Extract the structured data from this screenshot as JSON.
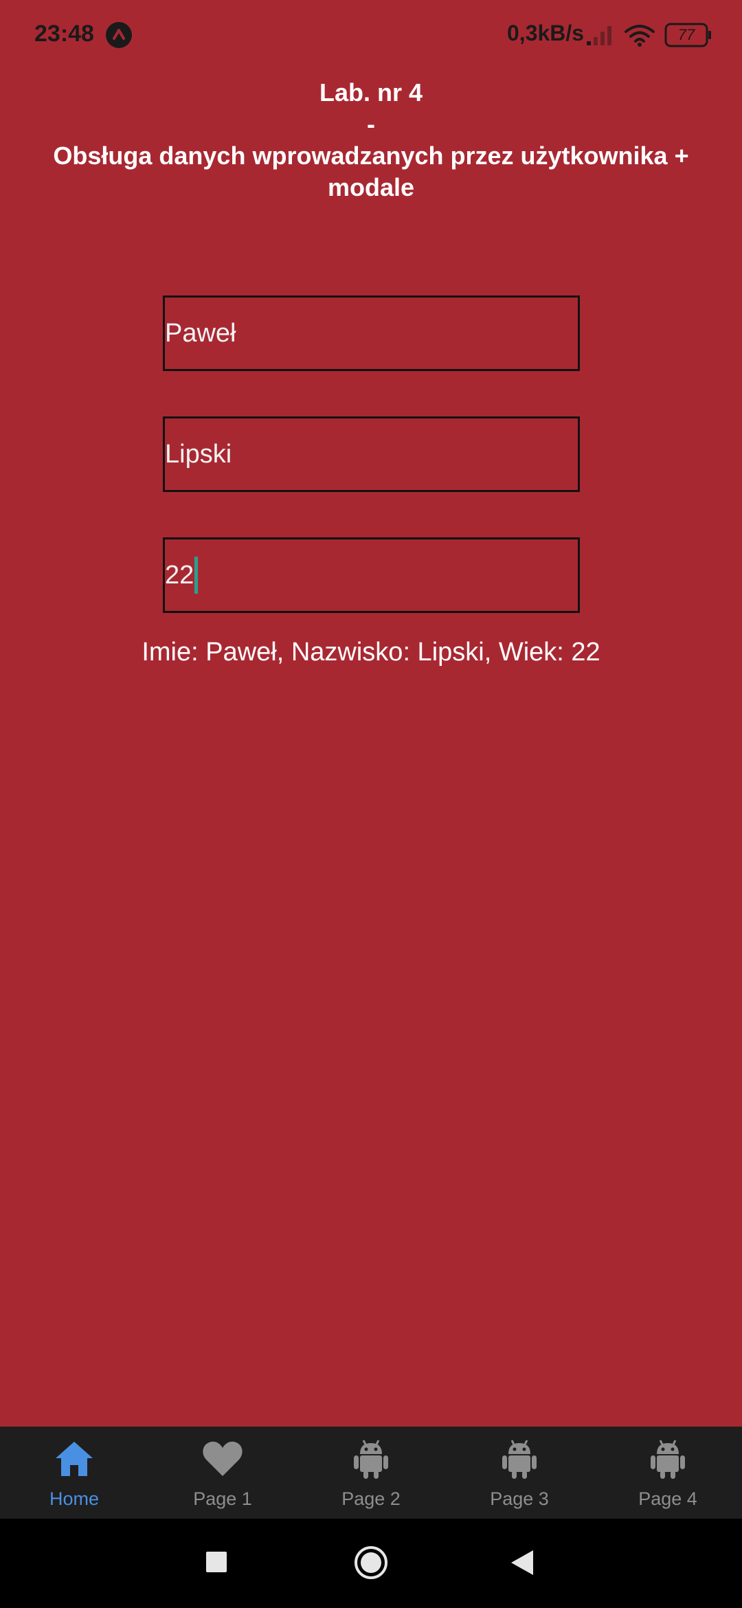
{
  "status_bar": {
    "time": "23:48",
    "network_speed": "0,3kB/s",
    "battery": "77"
  },
  "header": {
    "title_line1": "Lab. nr 4",
    "title_line2": "-",
    "title_line3": "Obsługa danych wprowadzanych przez użytkownika + modale"
  },
  "form": {
    "first_name": "Paweł",
    "last_name": "Lipski",
    "age": "22"
  },
  "summary": "Imie: Paweł, Nazwisko: Lipski, Wiek: 22",
  "tabs": [
    {
      "label": "Home",
      "icon": "home-icon",
      "active": true
    },
    {
      "label": "Page 1",
      "icon": "heart-icon",
      "active": false
    },
    {
      "label": "Page 2",
      "icon": "android-icon",
      "active": false
    },
    {
      "label": "Page 3",
      "icon": "android-icon",
      "active": false
    },
    {
      "label": "Page 4",
      "icon": "android-icon",
      "active": false
    }
  ],
  "colors": {
    "background": "#a82832",
    "tab_active": "#4a90e2",
    "tab_inactive": "#8e8e8e"
  }
}
